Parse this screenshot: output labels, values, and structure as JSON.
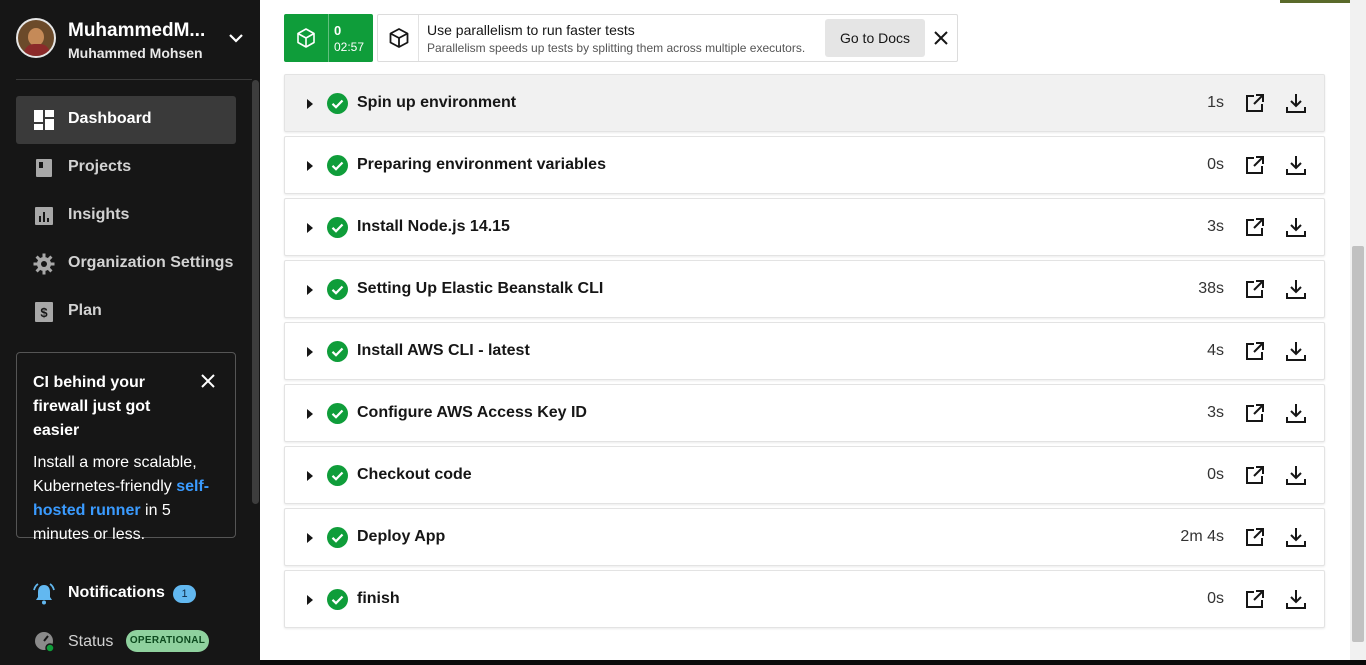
{
  "sidebar": {
    "org_name": "MuhammedM...",
    "user_name": "Muhammed Mohsen",
    "nav": [
      {
        "label": "Dashboard",
        "icon": "dashboard-icon",
        "active": true
      },
      {
        "label": "Projects",
        "icon": "projects-icon"
      },
      {
        "label": "Insights",
        "icon": "insights-icon"
      },
      {
        "label": "Organization Settings",
        "icon": "gear-icon"
      },
      {
        "label": "Plan",
        "icon": "plan-icon"
      }
    ],
    "promo": {
      "title": "CI behind your firewall just got easier",
      "body_before": "Install a more scalable, Kubernetes-friendly ",
      "link": "self-hosted runner",
      "body_after": " in 5 minutes or less."
    },
    "notifications": {
      "label": "Notifications",
      "count": "1"
    },
    "status": {
      "label": "Status",
      "badge": "OPERATIONAL"
    }
  },
  "timer": {
    "count": "0",
    "time": "02:57"
  },
  "banner": {
    "title": "Use parallelism to run faster tests",
    "subtitle": "Parallelism speeds up tests by splitting them across multiple executors.",
    "button": "Go to Docs"
  },
  "steps": [
    {
      "name": "Spin up environment",
      "duration": "1s"
    },
    {
      "name": "Preparing environment variables",
      "duration": "0s"
    },
    {
      "name": "Install Node.js 14.15",
      "duration": "3s"
    },
    {
      "name": "Setting Up Elastic Beanstalk CLI",
      "duration": "38s"
    },
    {
      "name": "Install AWS CLI - latest",
      "duration": "4s"
    },
    {
      "name": "Configure AWS Access Key ID",
      "duration": "3s"
    },
    {
      "name": "Checkout code",
      "duration": "0s"
    },
    {
      "name": "Deploy App",
      "duration": "2m 4s"
    },
    {
      "name": "finish",
      "duration": "0s"
    }
  ],
  "colors": {
    "success": "#0f9d3a",
    "link": "#3a9bff",
    "sidebar_bg": "#161616"
  }
}
